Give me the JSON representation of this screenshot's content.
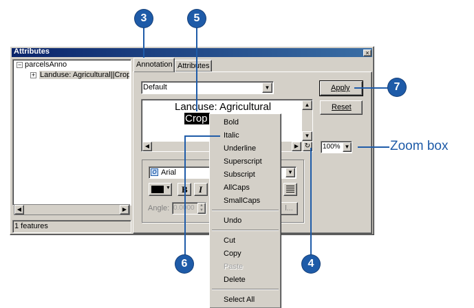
{
  "window": {
    "title": "Attributes",
    "close_glyph": "×"
  },
  "tree": {
    "root": "parcelsAnno",
    "child": "Landuse: Agricultural||Crop;",
    "root_toggle": "−",
    "child_toggle": "+"
  },
  "status": {
    "text": "1 features"
  },
  "tabs": [
    {
      "label": "Annotation"
    },
    {
      "label": "Attributes"
    }
  ],
  "symbol": {
    "value": "Default"
  },
  "buttons": {
    "apply": "Apply",
    "reset": "Reset"
  },
  "annotation_text": {
    "line1": "Landuse: Agricultural",
    "line2_selected": "Crop"
  },
  "zoom": {
    "value": "100%"
  },
  "font": {
    "name": "Arial",
    "bold": "B",
    "italic": "I"
  },
  "angle": {
    "label": "Angle:",
    "value": "0.0000"
  },
  "context_menu": {
    "group1": [
      "Bold",
      "Italic",
      "Underline",
      "Superscript",
      "Subscript",
      "AllCaps",
      "SmallCaps"
    ],
    "group2": [
      "Undo"
    ],
    "group3": [
      "Cut",
      "Copy",
      "Paste",
      "Delete"
    ],
    "group4": [
      "Select All"
    ],
    "disabled": "Paste"
  },
  "callouts": {
    "c3": "3",
    "c5": "5",
    "c7": "7",
    "c6": "6",
    "c4": "4",
    "zoom_label": "Zoom box"
  },
  "colors": {
    "title_bar": "#0a246a",
    "callout": "#1e5ba8",
    "dialog": "#d4d0c8"
  }
}
